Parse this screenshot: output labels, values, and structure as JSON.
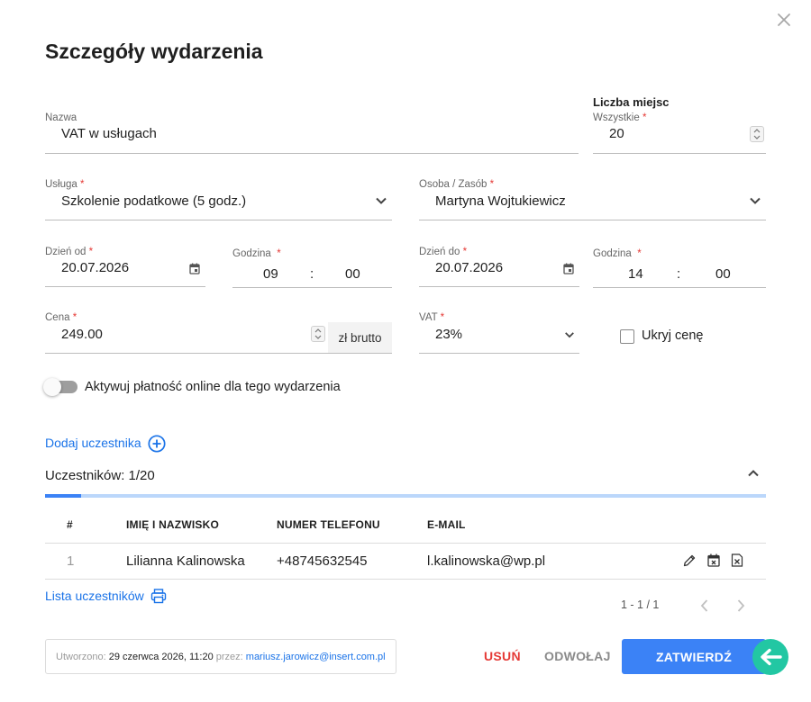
{
  "dialog": {
    "title": "Szczegóły wydarzenia",
    "close_icon": "close-icon"
  },
  "form": {
    "name": {
      "label": "Nazwa",
      "value": "VAT w usługach"
    },
    "seats": {
      "heading": "Liczba miejsc",
      "label": "Wszystkie",
      "required": "*",
      "value": "20"
    },
    "service": {
      "label": "Usługa",
      "required": "*",
      "value": "Szkolenie podatkowe (5 godz.)"
    },
    "person": {
      "label": "Osoba / Zasób",
      "required": "*",
      "value": "Martyna Wojtukiewicz"
    },
    "date_from": {
      "label": "Dzień od",
      "required": "*",
      "value": "20.07.2026"
    },
    "time_from": {
      "label": "Godzina",
      "required": "*",
      "hour": "09",
      "separator": ":",
      "minute": "00"
    },
    "date_to": {
      "label": "Dzień do",
      "required": "*",
      "value": "20.07.2026"
    },
    "time_to": {
      "label": "Godzina",
      "required": "*",
      "hour": "14",
      "separator": ":",
      "minute": "00"
    },
    "price": {
      "label": "Cena",
      "required": "*",
      "value": "249.00",
      "suffix": "zł brutto"
    },
    "vat": {
      "label": "VAT",
      "required": "*",
      "value": "23%"
    },
    "hide_price": {
      "label": "Ukryj cenę",
      "checked": false
    },
    "online_payment": {
      "label": "Aktywuj płatność online dla tego wydarzenia",
      "enabled": false
    }
  },
  "participants": {
    "add_label": "Dodaj uczestnika",
    "count_label": "Uczestników: 1/20",
    "progress": 0.05,
    "columns": [
      "#",
      "IMIĘ I NAZWISKO",
      "NUMER TELEFONU",
      "E-MAIL"
    ],
    "rows": [
      {
        "index": "1",
        "name": "Lilianna Kalinowska",
        "phone": "+48745632545",
        "email": "l.kalinowska@wp.pl"
      }
    ],
    "list_label": "Lista uczestników",
    "pagination": "1 - 1 / 1"
  },
  "footer": {
    "created_prefix": "Utworzono:",
    "created_date": "29 czerwca 2026, 11:20",
    "by_prefix": "przez:",
    "by_email": "mariusz.jarowicz@insert.com.pl",
    "delete_label": "USUŃ",
    "cancel_label": "ODWOŁAJ",
    "confirm_label": "ZATWIERDŹ"
  },
  "colors": {
    "accent": "#1a73e8",
    "primary_button": "#3b82f6",
    "delete": "#e53935",
    "progress_track": "#bbd7fb",
    "arrow_badge": "#22c7a3"
  }
}
